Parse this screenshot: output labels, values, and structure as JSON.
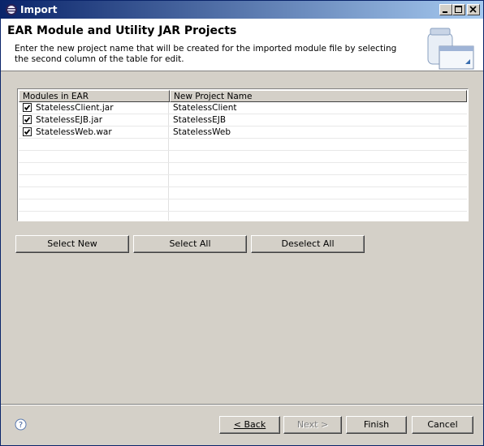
{
  "window": {
    "title": "Import"
  },
  "header": {
    "title": "EAR Module and Utility JAR Projects",
    "description": "Enter the new project name that will be created for the imported module file by selecting the second column of the table for edit."
  },
  "table": {
    "columns": [
      "Modules in EAR",
      "New Project Name"
    ],
    "rows": [
      {
        "module": "StatelessClient.jar",
        "project": "StatelessClient",
        "checked": true
      },
      {
        "module": "StatelessEJB.jar",
        "project": "StatelessEJB",
        "checked": true
      },
      {
        "module": "StatelessWeb.war",
        "project": "StatelessWeb",
        "checked": true
      }
    ]
  },
  "actions": {
    "select_new": "Select New",
    "select_all": "Select All",
    "deselect_all": "Deselect All"
  },
  "footer": {
    "back": "< Back",
    "next": "Next >",
    "finish": "Finish",
    "cancel": "Cancel"
  }
}
